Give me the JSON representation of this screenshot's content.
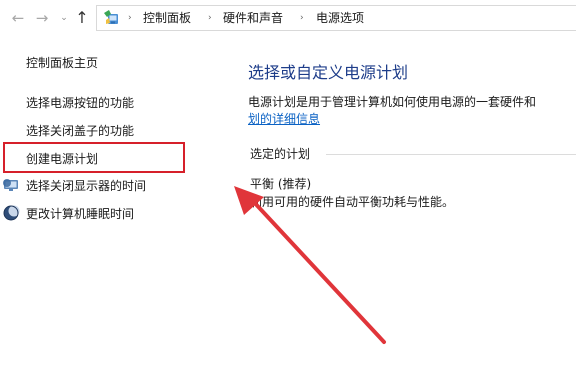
{
  "address_bar": {
    "back_glyph": "←",
    "forward_glyph": "→",
    "recent_glyph": "⌄",
    "up_glyph": "↑",
    "breadcrumbs": [
      "控制面板",
      "硬件和声音",
      "电源选项"
    ],
    "separator": "›"
  },
  "left_pane": {
    "home_link": "控制面板主页",
    "links": {
      "power_buttons": "选择电源按钮的功能",
      "lid_close": "选择关闭盖子的功能",
      "create_plan": "创建电源计划",
      "display_off": "选择关闭显示器的时间",
      "sleep_time": "更改计算机睡眠时间"
    }
  },
  "main": {
    "title": "选择或自定义电源计划",
    "description": "电源计划是用于管理计算机如何使用电源的一套硬件和",
    "description_link": "划的详细信息",
    "section_label": "选定的计划",
    "plan_name": "平衡 (推荐)",
    "plan_desc": "利用可用的硬件自动平衡功耗与性能。"
  },
  "colors": {
    "title_blue": "#1e3d8a",
    "link_blue": "#0b62c4",
    "highlight_red": "#d6202a",
    "arrow_red": "#e0353a"
  },
  "icons": {
    "control_panel": "control-panel-icon",
    "display": "display-shield-icon",
    "sleep": "moon-shield-icon"
  }
}
